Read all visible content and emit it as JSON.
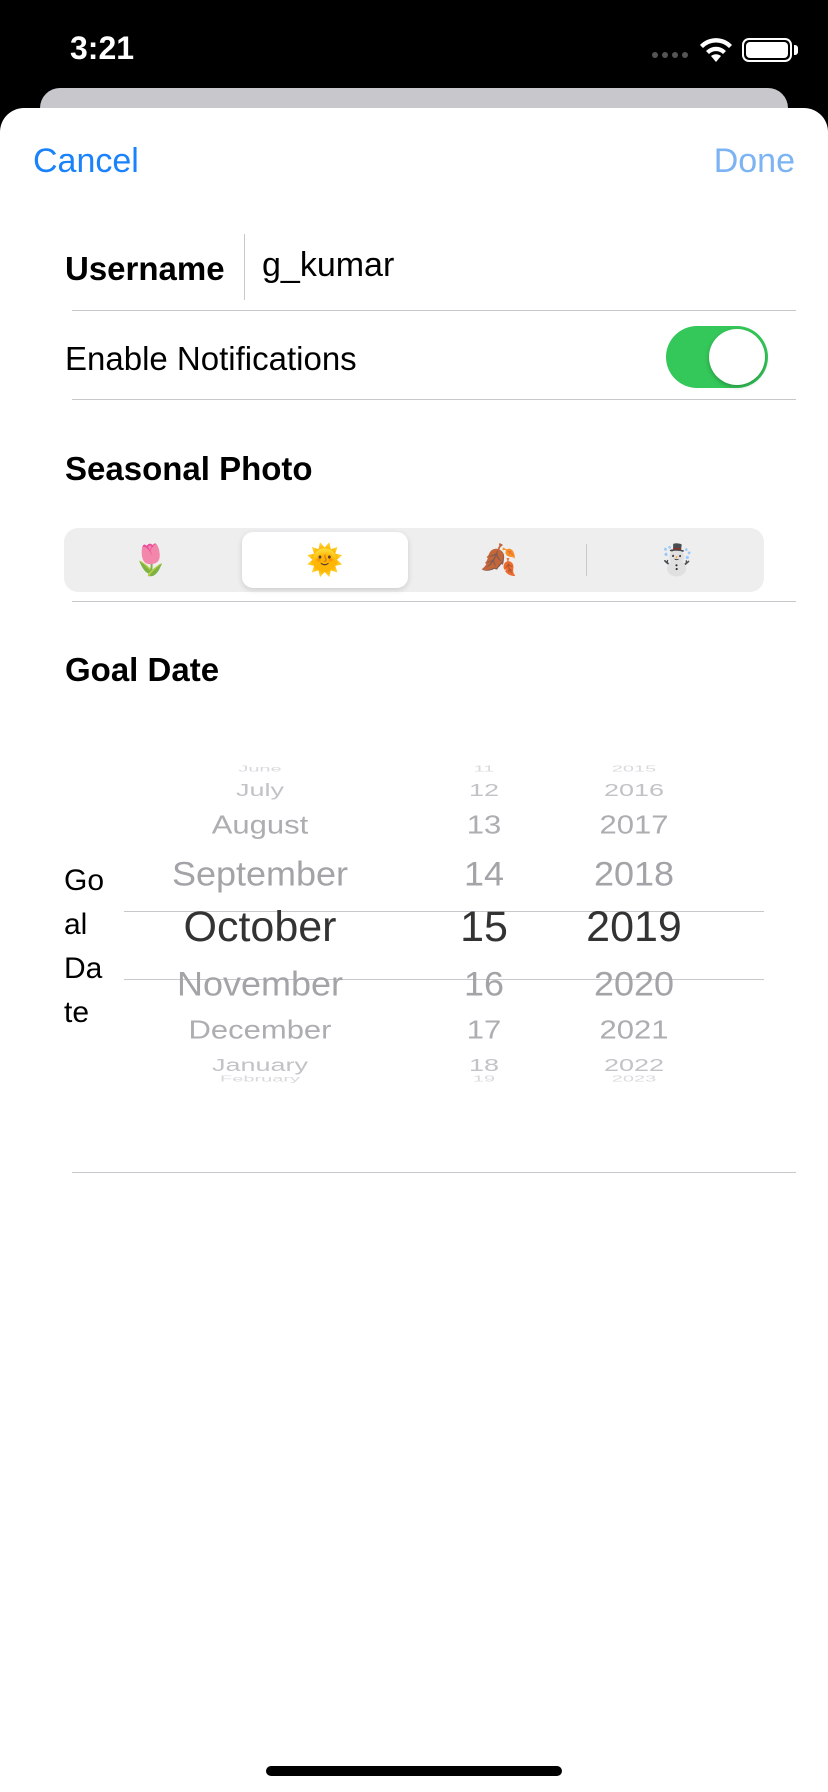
{
  "status": {
    "time": "3:21"
  },
  "nav": {
    "cancel_label": "Cancel",
    "done_label": "Done"
  },
  "form": {
    "username_label": "Username",
    "username_value": "g_kumar",
    "notifications_label": "Enable Notifications",
    "notifications_enabled": true,
    "seasonal_label": "Seasonal Photo",
    "seasons": [
      "🌷",
      "🌞",
      "🍂",
      "☃️"
    ],
    "selected_season_index": 1,
    "goal_date_label": "Goal Date",
    "goal_date_side_lines": [
      "Go",
      "al",
      "Da",
      "te"
    ]
  },
  "picker": {
    "months": [
      "June",
      "July",
      "August",
      "September",
      "October",
      "November",
      "December",
      "January",
      "February"
    ],
    "days": [
      "11",
      "12",
      "13",
      "14",
      "15",
      "16",
      "17",
      "18",
      "19"
    ],
    "years": [
      "2015",
      "2016",
      "2017",
      "2018",
      "2019",
      "2020",
      "2021",
      "2022",
      "2023"
    ],
    "selected": {
      "month": "October",
      "day": "15",
      "year": "2019"
    }
  },
  "colors": {
    "accent": "#1a82fb",
    "toggle_on": "#34c759"
  }
}
